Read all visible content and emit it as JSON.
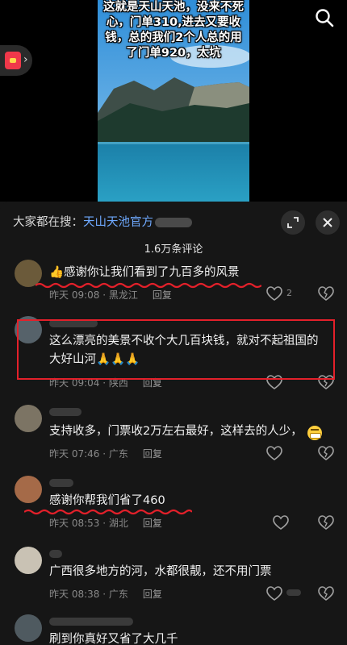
{
  "video": {
    "caption": "这就是天山天池，没来不死心，门单310,进去又要收钱，总的我们2个人总的用了门单920，太坑"
  },
  "icons": {
    "search": "search-icon",
    "redpacket": "red-packet-icon",
    "expand": "expand-icon",
    "close": "close-icon",
    "like": "heart-icon",
    "dislike": "broken-heart-icon"
  },
  "sheet": {
    "search_label": "大家都在搜：",
    "search_term": "天山天池官方",
    "comment_count": "1.6万条评论"
  },
  "comments": [
    {
      "text": "👍感谢你让我们看到了九百多的风景",
      "time": "昨天 09:08",
      "location": "黑龙江",
      "reply": "回复",
      "likes": "2"
    },
    {
      "text": "这么漂亮的美景不收个大几百块钱，就对不起祖国的大好山河🙏🙏🙏",
      "time": "昨天 09:04",
      "location": "陕西",
      "reply": "回复",
      "likes": ""
    },
    {
      "text": "支持收多，门票收2万左右最好，这样去的人少，",
      "time": "昨天 07:46",
      "location": "广东",
      "reply": "回复",
      "likes": ""
    },
    {
      "text": "感谢你帮我们省了460",
      "time": "昨天 08:53",
      "location": "湖北",
      "reply": "回复",
      "likes": ""
    },
    {
      "text": "广西很多地方的河，水都很靓，还不用门票",
      "time": "昨天 08:38",
      "location": "广东",
      "reply": "回复",
      "likes": ""
    },
    {
      "text": "刷到你真好又省了大几千",
      "time": "",
      "location": "",
      "reply": "",
      "likes": ""
    }
  ],
  "colors": {
    "accent_link": "#6fa9ff",
    "highlight_box": "#e3202a",
    "underline": "#e3202a"
  }
}
